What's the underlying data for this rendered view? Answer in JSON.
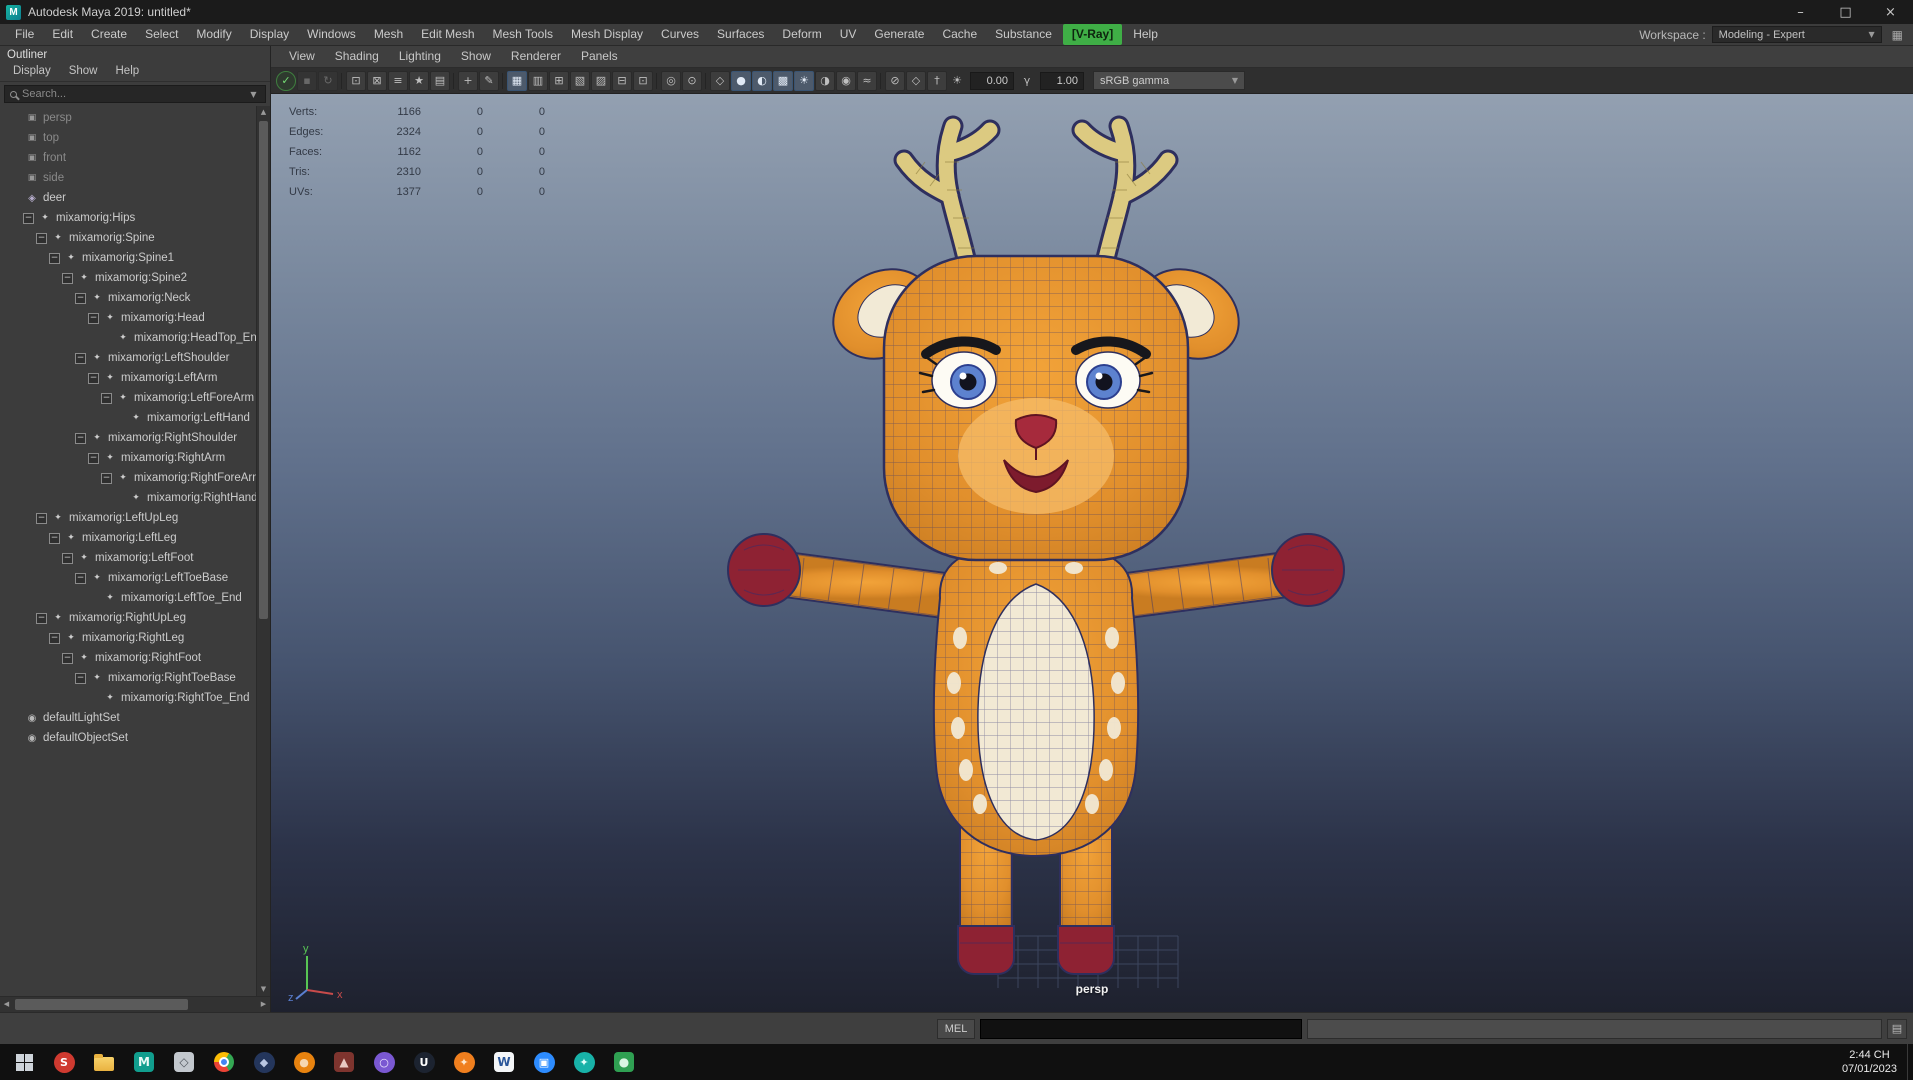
{
  "window": {
    "title": "Autodesk Maya 2019: untitled*",
    "app_initial": "M",
    "controls": {
      "minimize": "–",
      "maximize": "□",
      "close": "×"
    }
  },
  "menu_bar": {
    "items": [
      {
        "label": "File"
      },
      {
        "label": "Edit"
      },
      {
        "label": "Create"
      },
      {
        "label": "Select"
      },
      {
        "label": "Modify"
      },
      {
        "label": "Display"
      },
      {
        "label": "Windows"
      },
      {
        "label": "Mesh"
      },
      {
        "label": "Edit Mesh"
      },
      {
        "label": "Mesh Tools"
      },
      {
        "label": "Mesh Display"
      },
      {
        "label": "Curves"
      },
      {
        "label": "Surfaces"
      },
      {
        "label": "Deform"
      },
      {
        "label": "UV"
      },
      {
        "label": "Generate"
      },
      {
        "label": "Cache"
      },
      {
        "label": "Substance"
      },
      {
        "label": "[V-Ray]",
        "accent": true
      },
      {
        "label": "Help"
      }
    ],
    "workspace_label": "Workspace :",
    "workspace_value": "Modeling - Expert",
    "workspace_arrow": "▼",
    "workspace_icon": "▦"
  },
  "outliner": {
    "title": "Outliner",
    "menus": [
      "Display",
      "Show",
      "Help"
    ],
    "search_placeholder": "Search...",
    "filter_arrow": "▼",
    "scrollbar": {
      "up": "▲",
      "down": "▼",
      "left": "◀",
      "right": "▶"
    },
    "icon_glyphs": {
      "camera": "▣",
      "mesh": "◈",
      "joint": "✦",
      "set": "◉",
      "expander": "−"
    },
    "items": [
      {
        "label": "persp",
        "type": "camera",
        "level": 0,
        "dim": true
      },
      {
        "label": "top",
        "type": "camera",
        "level": 0,
        "dim": true
      },
      {
        "label": "front",
        "type": "camera",
        "level": 0,
        "dim": true
      },
      {
        "label": "side",
        "type": "camera",
        "level": 0,
        "dim": true
      },
      {
        "label": "deer",
        "type": "mesh",
        "level": 0
      },
      {
        "label": "mixamorig:Hips",
        "type": "joint",
        "level": 1,
        "exp": true
      },
      {
        "label": "mixamorig:Spine",
        "type": "joint",
        "level": 2,
        "exp": true
      },
      {
        "label": "mixamorig:Spine1",
        "type": "joint",
        "level": 3,
        "exp": true
      },
      {
        "label": "mixamorig:Spine2",
        "type": "joint",
        "level": 4,
        "exp": true
      },
      {
        "label": "mixamorig:Neck",
        "type": "joint",
        "level": 5,
        "exp": true
      },
      {
        "label": "mixamorig:Head",
        "type": "joint",
        "level": 6,
        "exp": true
      },
      {
        "label": "mixamorig:HeadTop_End",
        "type": "joint",
        "level": 7
      },
      {
        "label": "mixamorig:LeftShoulder",
        "type": "joint",
        "level": 5,
        "exp": true
      },
      {
        "label": "mixamorig:LeftArm",
        "type": "joint",
        "level": 6,
        "exp": true
      },
      {
        "label": "mixamorig:LeftForeArm",
        "type": "joint",
        "level": 7,
        "exp": true
      },
      {
        "label": "mixamorig:LeftHand",
        "type": "joint",
        "level": 8
      },
      {
        "label": "mixamorig:RightShoulder",
        "type": "joint",
        "level": 5,
        "exp": true
      },
      {
        "label": "mixamorig:RightArm",
        "type": "joint",
        "level": 6,
        "exp": true
      },
      {
        "label": "mixamorig:RightForeArm",
        "type": "joint",
        "level": 7,
        "exp": true
      },
      {
        "label": "mixamorig:RightHand",
        "type": "joint",
        "level": 8
      },
      {
        "label": "mixamorig:LeftUpLeg",
        "type": "joint",
        "level": 2,
        "exp": true
      },
      {
        "label": "mixamorig:LeftLeg",
        "type": "joint",
        "level": 3,
        "exp": true
      },
      {
        "label": "mixamorig:LeftFoot",
        "type": "joint",
        "level": 4,
        "exp": true
      },
      {
        "label": "mixamorig:LeftToeBase",
        "type": "joint",
        "level": 5,
        "exp": true
      },
      {
        "label": "mixamorig:LeftToe_End",
        "type": "joint",
        "level": 6
      },
      {
        "label": "mixamorig:RightUpLeg",
        "type": "joint",
        "level": 2,
        "exp": true
      },
      {
        "label": "mixamorig:RightLeg",
        "type": "joint",
        "level": 3,
        "exp": true
      },
      {
        "label": "mixamorig:RightFoot",
        "type": "joint",
        "level": 4,
        "exp": true
      },
      {
        "label": "mixamorig:RightToeBase",
        "type": "joint",
        "level": 5,
        "exp": true
      },
      {
        "label": "mixamorig:RightToe_End",
        "type": "joint",
        "level": 6
      },
      {
        "label": "defaultLightSet",
        "type": "set",
        "level": 0
      },
      {
        "label": "defaultObjectSet",
        "type": "set",
        "level": 0
      }
    ]
  },
  "viewport": {
    "menus": [
      "View",
      "Shading",
      "Lighting",
      "Show",
      "Renderer",
      "Panels"
    ],
    "toolbar": {
      "icons": [
        {
          "name": "renderer-status-icon",
          "glyph": "✓",
          "state": "green"
        },
        {
          "name": "viewport-pause-icon",
          "glyph": "▪",
          "state": "dim"
        },
        {
          "name": "viewport-refresh-icon",
          "glyph": "↻",
          "state": "dim"
        },
        {
          "sep": true
        },
        {
          "name": "select-camera-icon",
          "glyph": "⊡",
          "state": "normal"
        },
        {
          "name": "lock-camera-icon",
          "glyph": "⊠",
          "state": "normal"
        },
        {
          "name": "camera-attributes-icon",
          "glyph": "≡",
          "state": "normal"
        },
        {
          "name": "bookmarks-icon",
          "glyph": "★",
          "state": "normal"
        },
        {
          "name": "image-plane-icon",
          "glyph": "▤",
          "state": "normal"
        },
        {
          "sep": true
        },
        {
          "name": "pan-zoom-icon",
          "glyph": "+",
          "state": "normal"
        },
        {
          "name": "grease-pencil-icon",
          "glyph": "✎",
          "state": "normal"
        },
        {
          "sep": true
        },
        {
          "name": "grid-icon",
          "glyph": "▦",
          "state": "active"
        },
        {
          "name": "film-gate-icon",
          "glyph": "▥",
          "state": "normal"
        },
        {
          "name": "resolution-gate-icon",
          "glyph": "⊞",
          "state": "normal"
        },
        {
          "name": "gate-mask-icon",
          "glyph": "▧",
          "state": "normal"
        },
        {
          "name": "field-chart-icon",
          "glyph": "▨",
          "state": "normal"
        },
        {
          "name": "safe-action-icon",
          "glyph": "⊟",
          "state": "normal"
        },
        {
          "name": "safe-title-icon",
          "glyph": "⊡",
          "state": "normal"
        },
        {
          "sep": true
        },
        {
          "name": "frame-all-icon",
          "glyph": "◎",
          "state": "normal"
        },
        {
          "name": "frame-selected-icon",
          "glyph": "⊙",
          "state": "normal"
        },
        {
          "sep": true
        },
        {
          "name": "wireframe-icon",
          "glyph": "◇",
          "state": "normal"
        },
        {
          "name": "smooth-shade-icon",
          "glyph": "●",
          "state": "active"
        },
        {
          "name": "wireframe-on-shaded-icon",
          "glyph": "◐",
          "state": "active"
        },
        {
          "name": "textured-icon",
          "glyph": "▩",
          "state": "active"
        },
        {
          "name": "use-all-lights-icon",
          "glyph": "☀",
          "state": "active"
        },
        {
          "name": "shadows-icon",
          "glyph": "◑",
          "state": "normal"
        },
        {
          "name": "screen-ao-icon",
          "glyph": "◉",
          "state": "normal"
        },
        {
          "name": "motion-blur-icon",
          "glyph": "≈",
          "state": "normal"
        },
        {
          "sep": true
        },
        {
          "name": "isolate-select-icon",
          "glyph": "⊘",
          "state": "normal"
        },
        {
          "name": "xray-icon",
          "glyph": "◇",
          "state": "normal"
        },
        {
          "name": "joints-xray-icon",
          "glyph": "†",
          "state": "normal"
        }
      ],
      "exposure_icon": "☀",
      "exposure_value": "0.00",
      "gamma_icon": "γ",
      "gamma_value": "1.00",
      "colorspace": "sRGB gamma",
      "dropdown_arrow": "▼"
    },
    "hud": {
      "rows": [
        {
          "label": "Verts:",
          "values": [
            "1166",
            "0",
            "0"
          ]
        },
        {
          "label": "Edges:",
          "values": [
            "2324",
            "0",
            "0"
          ]
        },
        {
          "label": "Faces:",
          "values": [
            "1162",
            "0",
            "0"
          ]
        },
        {
          "label": "Tris:",
          "values": [
            "2310",
            "0",
            "0"
          ]
        },
        {
          "label": "UVs:",
          "values": [
            "1377",
            "0",
            "0"
          ]
        }
      ]
    },
    "camera_label": "persp",
    "axis": {
      "x": "x",
      "y": "y",
      "z": "z"
    }
  },
  "command_line": {
    "label": "MEL",
    "script_editor_icon": "▤"
  },
  "taskbar": {
    "clock_time": "2:44 CH",
    "clock_date": "07/01/2023",
    "icons": [
      {
        "name": "start-button",
        "kind": "win"
      },
      {
        "name": "taskbar-app-red-s",
        "kind": "circle",
        "bg": "#cf3a30",
        "glyph": "S",
        "fg": "#ffffff"
      },
      {
        "name": "file-explorer",
        "kind": "folder"
      },
      {
        "name": "taskbar-app-maya",
        "kind": "square",
        "bg": "#119e8e",
        "glyph": "M",
        "fg": "#eafaf7"
      },
      {
        "name": "taskbar-app-silver",
        "kind": "square",
        "bg": "#c3c8ce",
        "glyph": "◇",
        "fg": "#50565e"
      },
      {
        "name": "taskbar-app-chrome",
        "kind": "chrome"
      },
      {
        "name": "taskbar-app-navy",
        "kind": "circle",
        "bg": "#24365c",
        "glyph": "◆",
        "fg": "#b9c6e2"
      },
      {
        "name": "taskbar-app-orange",
        "kind": "circle",
        "bg": "#e8830f",
        "glyph": "●",
        "fg": "#f6d7b0"
      },
      {
        "name": "taskbar-app-maroon",
        "kind": "square",
        "bg": "#7e342e",
        "glyph": "▲",
        "fg": "#e9c9c2"
      },
      {
        "name": "taskbar-app-purple",
        "kind": "circle",
        "bg": "#7a58d2",
        "glyph": "○",
        "fg": "#efe9ff"
      },
      {
        "name": "taskbar-app-u",
        "kind": "circle",
        "bg": "#1c2330",
        "glyph": "U",
        "fg": "#ffffff"
      },
      {
        "name": "taskbar-app-flame",
        "kind": "circle",
        "bg": "#f07f1e",
        "glyph": "✦",
        "fg": "#fde8cf"
      },
      {
        "name": "taskbar-app-word",
        "kind": "square",
        "bg": "#f4f6f8",
        "glyph": "W",
        "fg": "#2b579a"
      },
      {
        "name": "taskbar-app-zoom",
        "kind": "circle",
        "bg": "#2d8cff",
        "glyph": "▣",
        "fg": "#ffffff"
      },
      {
        "name": "taskbar-app-teal",
        "kind": "circle",
        "bg": "#18b2a8",
        "glyph": "✦",
        "fg": "#e2fffb"
      },
      {
        "name": "taskbar-app-green",
        "kind": "square",
        "bg": "#2fa052",
        "glyph": "●",
        "fg": "#d9f5e2"
      }
    ]
  }
}
